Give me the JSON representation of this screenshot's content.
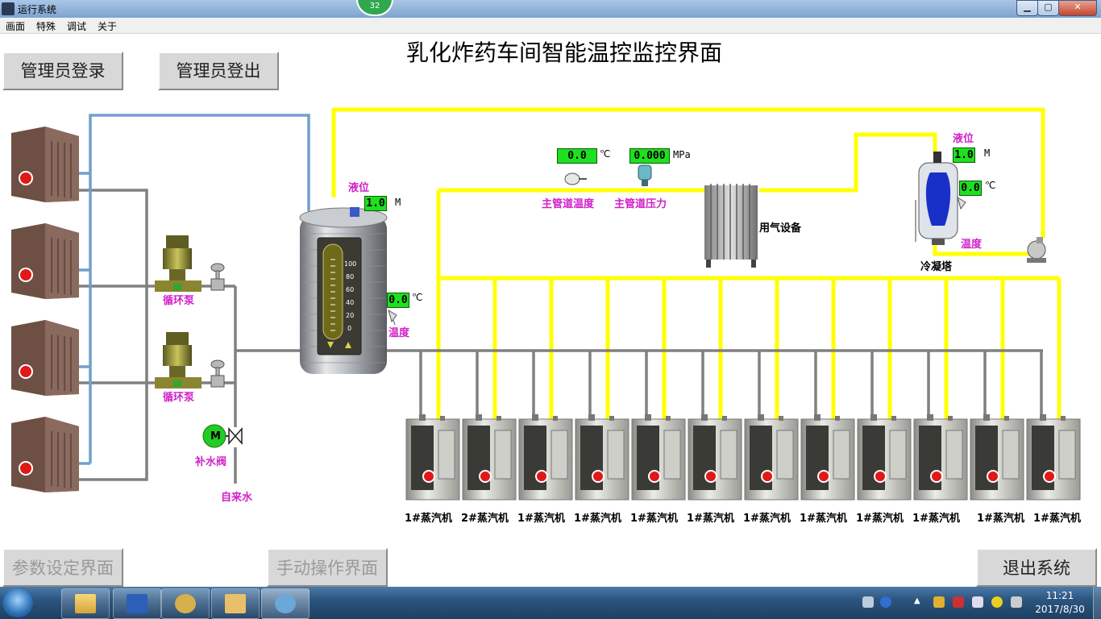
{
  "window": {
    "title": "运行系统",
    "badge": "32",
    "controls": {
      "minimize": "▁",
      "maximize": "▢",
      "close": "✕"
    }
  },
  "menu": [
    "画面",
    "特殊",
    "调试",
    "关于"
  ],
  "page_title": "乳化炸药车间智能温控监控界面",
  "buttons": {
    "admin_login": "管理员登录",
    "admin_logout": "管理员登出",
    "param_settings": "参数设定界面",
    "manual_ops": "手动操作界面",
    "exit": "退出系统"
  },
  "labels": {
    "circ_pump_1": "循环泵",
    "circ_pump_2": "循环泵",
    "makeup_valve": "补水阀",
    "motor": "M",
    "tap_water": "自来水",
    "tank_level": "液位",
    "tank_temp": "温度",
    "main_pipe_temp": "主管道温度",
    "main_pipe_pressure": "主管道压力",
    "gas_equipment": "用气设备",
    "condenser_level": "液位",
    "condenser_temp": "温度",
    "condenser": "冷凝塔"
  },
  "readings": {
    "tank_level": {
      "value": "1.0",
      "unit": "M"
    },
    "tank_temp": {
      "value": "0.0",
      "unit": "℃"
    },
    "main_temp": {
      "value": "0.0",
      "unit": "℃"
    },
    "main_pressure": {
      "value": "0.000",
      "unit": "MPa"
    },
    "cond_level": {
      "value": "1.0",
      "unit": "M"
    },
    "cond_temp": {
      "value": "0.0",
      "unit": "℃"
    }
  },
  "tank_scale": [
    "100",
    "80",
    "60",
    "40",
    "20",
    "0"
  ],
  "steam_machines": [
    "1#蒸汽机",
    "2#蒸汽机",
    "1#蒸汽机",
    "1#蒸汽机",
    "1#蒸汽机",
    "1#蒸汽机",
    "1#蒸汽机",
    "1#蒸汽机",
    "1#蒸汽机",
    "1#蒸汽机",
    "1#蒸汽机",
    "1#蒸汽机"
  ],
  "taskbar": {
    "apps": [
      "file-explorer",
      "word",
      "settings",
      "docs",
      "running-system"
    ],
    "time": "11:21",
    "date": "2017/8/30"
  },
  "colors": {
    "steam_pipe": "#ffff00",
    "water_pipe": "#808080",
    "cold_pipe": "#6fa0cc",
    "display": "#1ee01e",
    "label": "#d020c8"
  }
}
